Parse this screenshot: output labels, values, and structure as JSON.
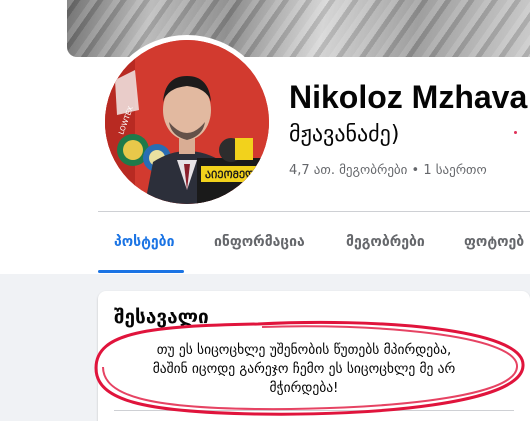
{
  "profile": {
    "name": "Nikoloz Mzhava",
    "alt_name": "მჟავანაძე)",
    "friends_text": "4,7 ათ. მეგობრები • 1 საერთო"
  },
  "avatar": {
    "badge_text": "ᲐᲘᲔᲝᲛᲔᲓᲘ",
    "logo_text": "LOWTEX"
  },
  "tabs": [
    {
      "label": "პოსტები",
      "active": true
    },
    {
      "label": "ინფორმაცია",
      "active": false
    },
    {
      "label": "მეგობრები",
      "active": false
    },
    {
      "label": "ფოტოებ",
      "active": false
    }
  ],
  "intro": {
    "title": "შესავალი",
    "bio_line1": "თუ ეს სიცოცხლე უშენობის წუთებს მპირდება,",
    "bio_line2": "მაშინ იცოდე გარეჯო ჩემო ეს სიცოცხლე მე არ",
    "bio_line3": "მჭირდება!"
  },
  "colors": {
    "accent": "#1b74e4",
    "annotation": "#e0143c",
    "avatar_bg": "#d23a2f"
  }
}
